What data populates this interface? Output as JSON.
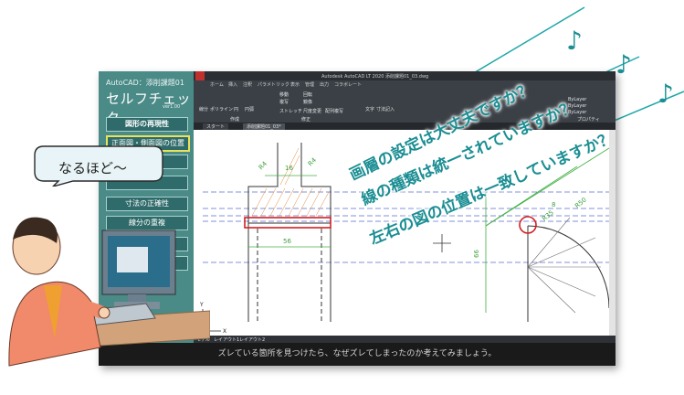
{
  "panel": {
    "app_label": "AutoCAD：添削課題01",
    "title": "セルフチェック",
    "version": "ver1.00",
    "buttons": [
      {
        "label": "図形の再現性",
        "state": "title"
      },
      {
        "label": "正面図・側面図の位置",
        "state": "active"
      },
      {
        "label": "",
        "state": "normal"
      },
      {
        "label": "",
        "state": "normal"
      },
      {
        "label": "寸法の正確性",
        "state": "normal"
      },
      {
        "label": "線分の重複",
        "state": "normal"
      },
      {
        "label": "",
        "state": "normal"
      },
      {
        "label": "",
        "state": "normal"
      }
    ]
  },
  "acad": {
    "window_title": "Autodesk AutoCAD LT 2020  添削課題01_03.dwg",
    "ribbon_tabs": [
      "ホーム",
      "挿入",
      "注釈",
      "パラメトリック",
      "表示",
      "管理",
      "出力",
      "コラボレート"
    ],
    "tools": [
      "線分",
      "ポリライン",
      "円",
      "円弧",
      "移動",
      "回転",
      "複写",
      "鏡像",
      "ストレッチ",
      "尺度変更",
      "配列複写",
      "文字",
      "寸法記入"
    ],
    "groups": [
      "作成",
      "修正"
    ],
    "file_tabs": [
      "スタート",
      "添削課題01_03*"
    ],
    "layout_tabs": [
      "モデル",
      "レイアウト1",
      "レイアウト2"
    ],
    "layer_value": "ByLayer",
    "properties_label": "プロパティ"
  },
  "drawing": {
    "dims": [
      "R4",
      "16",
      "R4",
      "56",
      "8",
      "R35",
      "R50",
      "66"
    ],
    "axis_y": "Y",
    "axis_x": "X"
  },
  "caption": "ズレている箇所を見つけたら、なぜズレてしまったのか考えてみましょう。",
  "overlay": {
    "lines": [
      "画層の設定は大丈夫ですか？",
      "線の種類は統一されていますか？",
      "左右の図の位置は一致していますか？"
    ],
    "note_glyph": "♪"
  },
  "bubble": {
    "text": "なるほど～"
  },
  "colors": {
    "teal": "#1b8e93",
    "panel": "#4a8a87",
    "highlight": "#e8e35a",
    "red_mark": "#d42020"
  }
}
